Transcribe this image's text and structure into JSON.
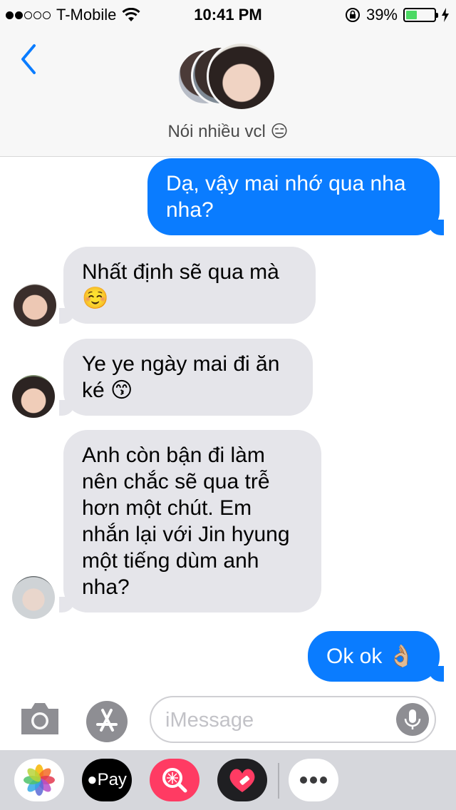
{
  "status_bar": {
    "carrier": "T-Mobile",
    "signal_bars_filled": 2,
    "signal_bars_total": 5,
    "time": "10:41 PM",
    "battery_percent": "39%",
    "battery_level": 0.39,
    "battery_fill_color": "#4cd964"
  },
  "header": {
    "thread_title": "Nói nhiều vcl 😑",
    "back_icon": "chevron-left-icon",
    "accent_color": "#0a7cff"
  },
  "messages": [
    {
      "direction": "outgoing",
      "text": "Dạ, vậy mai nhớ qua nha nha?"
    },
    {
      "direction": "incoming",
      "text": "Nhất định sẽ qua mà ☺️"
    },
    {
      "direction": "incoming",
      "text": "Ye ye ngày mai đi ăn ké 😙"
    },
    {
      "direction": "incoming",
      "text": "Anh còn bận đi làm nên chắc sẽ qua trễ hơn một chút. Em nhắn lại với Jin hyung một tiếng dùm anh nha?"
    },
    {
      "direction": "outgoing",
      "text": "Ok ok 👌🏼"
    }
  ],
  "input_bar": {
    "placeholder": "iMessage",
    "camera_icon": "camera-icon",
    "appstore_icon": "app-store-icon",
    "mic_icon": "microphone-icon"
  },
  "app_drawer": {
    "items": [
      {
        "name": "photos-icon"
      },
      {
        "name": "apple-pay-icon",
        "label": "Pay"
      },
      {
        "name": "search-images-icon"
      },
      {
        "name": "digital-touch-icon"
      },
      {
        "name": "more-apps-icon"
      }
    ]
  }
}
